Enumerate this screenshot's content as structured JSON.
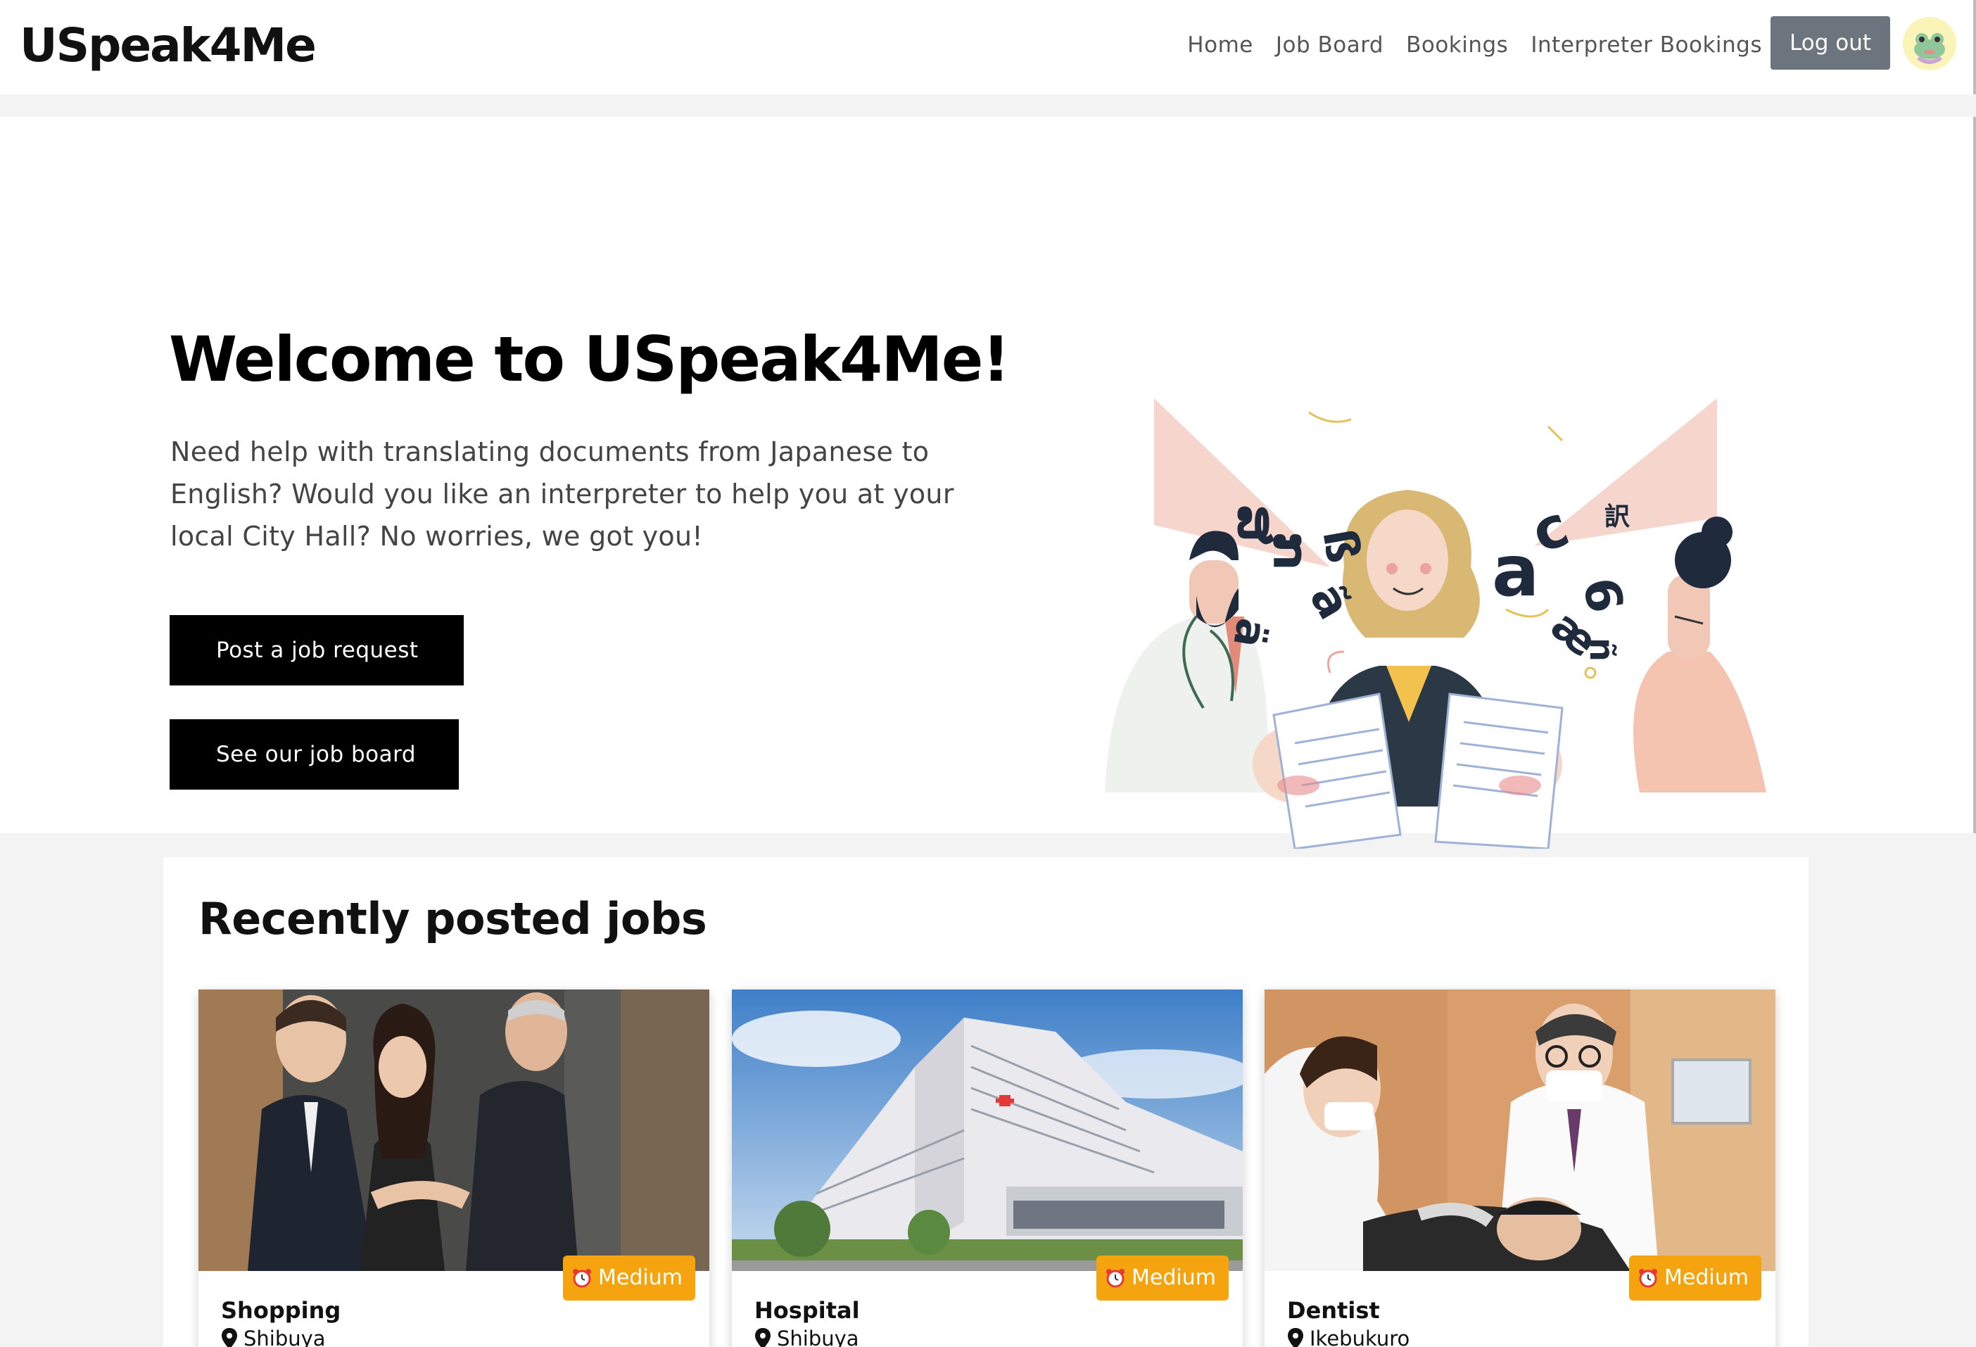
{
  "navbar": {
    "brand": "USpeak4Me",
    "links": [
      "Home",
      "Job Board",
      "Bookings",
      "Interpreter Bookings"
    ],
    "logout_label": "Log out",
    "avatar_icon": "frog-avatar-icon"
  },
  "hero": {
    "title": "Welcome to USpeak4Me!",
    "description": "Need help with translating documents from Japanese to English? Would you like an interpreter to help you at your local City Hall? No worries, we got you!",
    "post_button": "Post a job request",
    "board_button": "See our job board",
    "illustration_icon": "interpreter-illustration",
    "illustration_glyphs": [
      "ສ",
      "ກ",
      "ã",
      "ß",
      "ä",
      "a",
      "c",
      "6",
      "æ",
      "ñ",
      "訳"
    ]
  },
  "recent": {
    "title": "Recently posted jobs",
    "jobs": [
      {
        "title": "Shopping",
        "location": "Shibuya",
        "urgency": "Medium",
        "image": "business-handshake-photo"
      },
      {
        "title": "Hospital",
        "location": "Shibuya",
        "urgency": "Medium",
        "image": "hospital-building-photo"
      },
      {
        "title": "Dentist",
        "location": "Ikebukuro",
        "urgency": "Medium",
        "image": "dentist-office-photo"
      }
    ]
  },
  "colors": {
    "accent": "#f5a30f",
    "logout_bg": "#6c757d",
    "button_bg": "#000000",
    "avatar_bg": "#fbf4b8"
  }
}
